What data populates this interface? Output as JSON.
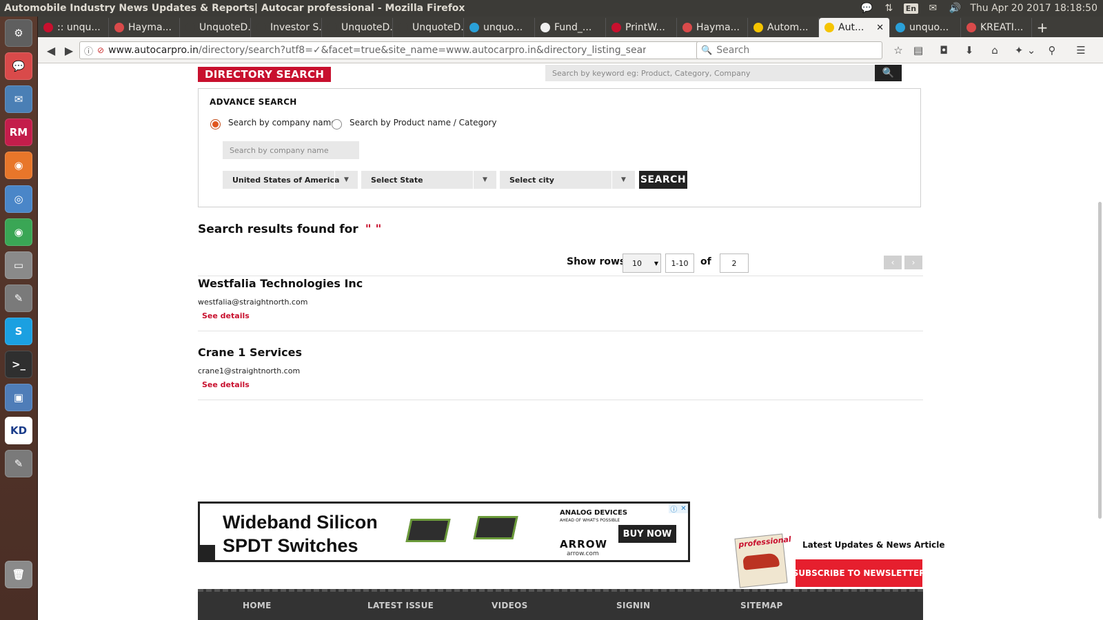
{
  "os": {
    "window_title": "Automobile Industry News Updates & Reports| Autocar professional - Mozilla Firefox",
    "lang": "En",
    "clock": "Thu Apr 20 2017 18:18:50",
    "tray_icons": [
      "chat-icon",
      "network-icon",
      "language-icon",
      "mail-icon",
      "volume-icon"
    ]
  },
  "launcher": {
    "items": [
      {
        "name": "ubuntu-home-icon",
        "color": "#5f5f5f",
        "label": "⚙"
      },
      {
        "name": "pidgin-icon",
        "color": "#d94a4a",
        "label": "💬"
      },
      {
        "name": "thunderbird-icon",
        "color": "#4a7fb5",
        "label": "✉"
      },
      {
        "name": "rubymine-icon",
        "color": "#c41d4b",
        "label": "RM"
      },
      {
        "name": "firefox-icon",
        "color": "#e8762a",
        "label": "◉"
      },
      {
        "name": "chromium-icon",
        "color": "#4a86c8",
        "label": "◎"
      },
      {
        "name": "chrome-icon",
        "color": "#3aa655",
        "label": "◉"
      },
      {
        "name": "files-icon",
        "color": "#8a8a8a",
        "label": "▭"
      },
      {
        "name": "text-editor-icon",
        "color": "#7a7a7a",
        "label": "✎"
      },
      {
        "name": "skype-icon",
        "color": "#1ba0e1",
        "label": "S"
      },
      {
        "name": "terminal-icon",
        "color": "#2f2f2f",
        "label": ">_"
      },
      {
        "name": "virtualbox-icon",
        "color": "#4f7db8",
        "label": "▣"
      },
      {
        "name": "kdiff3-icon",
        "color": "#ffffff",
        "label": "KD"
      },
      {
        "name": "gedit-icon",
        "color": "#7a7a7a",
        "label": "✎"
      },
      {
        "name": "trash-icon",
        "color": "#8a8a8a",
        "label": "🗑"
      }
    ]
  },
  "browser": {
    "tabs": [
      {
        "label": ":: unqu...",
        "fav": "#c8102e"
      },
      {
        "label": "Hayma...",
        "fav": "#d94a4a"
      },
      {
        "label": "UnquoteD...",
        "fav": "#3e3d39"
      },
      {
        "label": "Investor S...",
        "fav": "#3e3d39"
      },
      {
        "label": "UnquoteD...",
        "fav": "#3e3d39"
      },
      {
        "label": "UnquoteD...",
        "fav": "#3e3d39"
      },
      {
        "label": "unquo...",
        "fav": "#2aa0d8"
      },
      {
        "label": "Fund_...",
        "fav": "#f0f0f0"
      },
      {
        "label": "PrintW...",
        "fav": "#c8102e"
      },
      {
        "label": "Hayma...",
        "fav": "#d94a4a"
      },
      {
        "label": "Autom...",
        "fav": "#f5c400"
      },
      {
        "label": "Aut...",
        "fav": "#f5c400",
        "active": true
      },
      {
        "label": "unquo...",
        "fav": "#2aa0d8"
      },
      {
        "label": "KREATI...",
        "fav": "#d94a4a"
      }
    ],
    "url_host": "www.autocarpro.in",
    "url_rest": "/directory/search?utf8=✓&facet=true&site_name=www.autocarpro.in&directory_listing_search",
    "search_placeholder": "Search"
  },
  "page": {
    "directory_title": "DIRECTORY SEARCH",
    "keyword_placeholder": "Search by keyword eg: Product, Category, Company",
    "advance_search_title": "ADVANCE SEARCH",
    "radio_company": "Search by company name",
    "radio_product": "Search by Product name / Category",
    "company_placeholder": "Search by company name",
    "country": "United States of America",
    "state": "Select State",
    "city": "Select city",
    "search_button": "SEARCH",
    "results_heading": "Search results found for",
    "results_query": "\" \"",
    "show_rows_label": "Show rows",
    "rows_value": "10",
    "range": "1-10",
    "of_label": "of",
    "total": "2",
    "results": [
      {
        "name": "Westfalia Technologies Inc",
        "email": "westfalia@straightnorth.com",
        "details": "See details"
      },
      {
        "name": "Crane 1 Services",
        "email": "crane1@straightnorth.com",
        "details": "See details"
      }
    ],
    "ad": {
      "headline_1": "Wideband Silicon",
      "headline_2": "SPDT Switches",
      "brand": "ANALOG DEVICES",
      "brand_tag": "AHEAD OF WHAT'S POSSIBLE",
      "partner": "ARROW",
      "partner_url": "arrow.com",
      "cta": "BUY NOW"
    },
    "magazine_title": "professional",
    "latest_updates": "Latest Updates & News Article",
    "newsletter_button": "SUBSCRIBE TO NEWSLETTER",
    "footer_links": [
      "HOME",
      "LATEST ISSUE",
      "VIDEOS",
      "SIGNIN",
      "SITEMAP"
    ]
  }
}
